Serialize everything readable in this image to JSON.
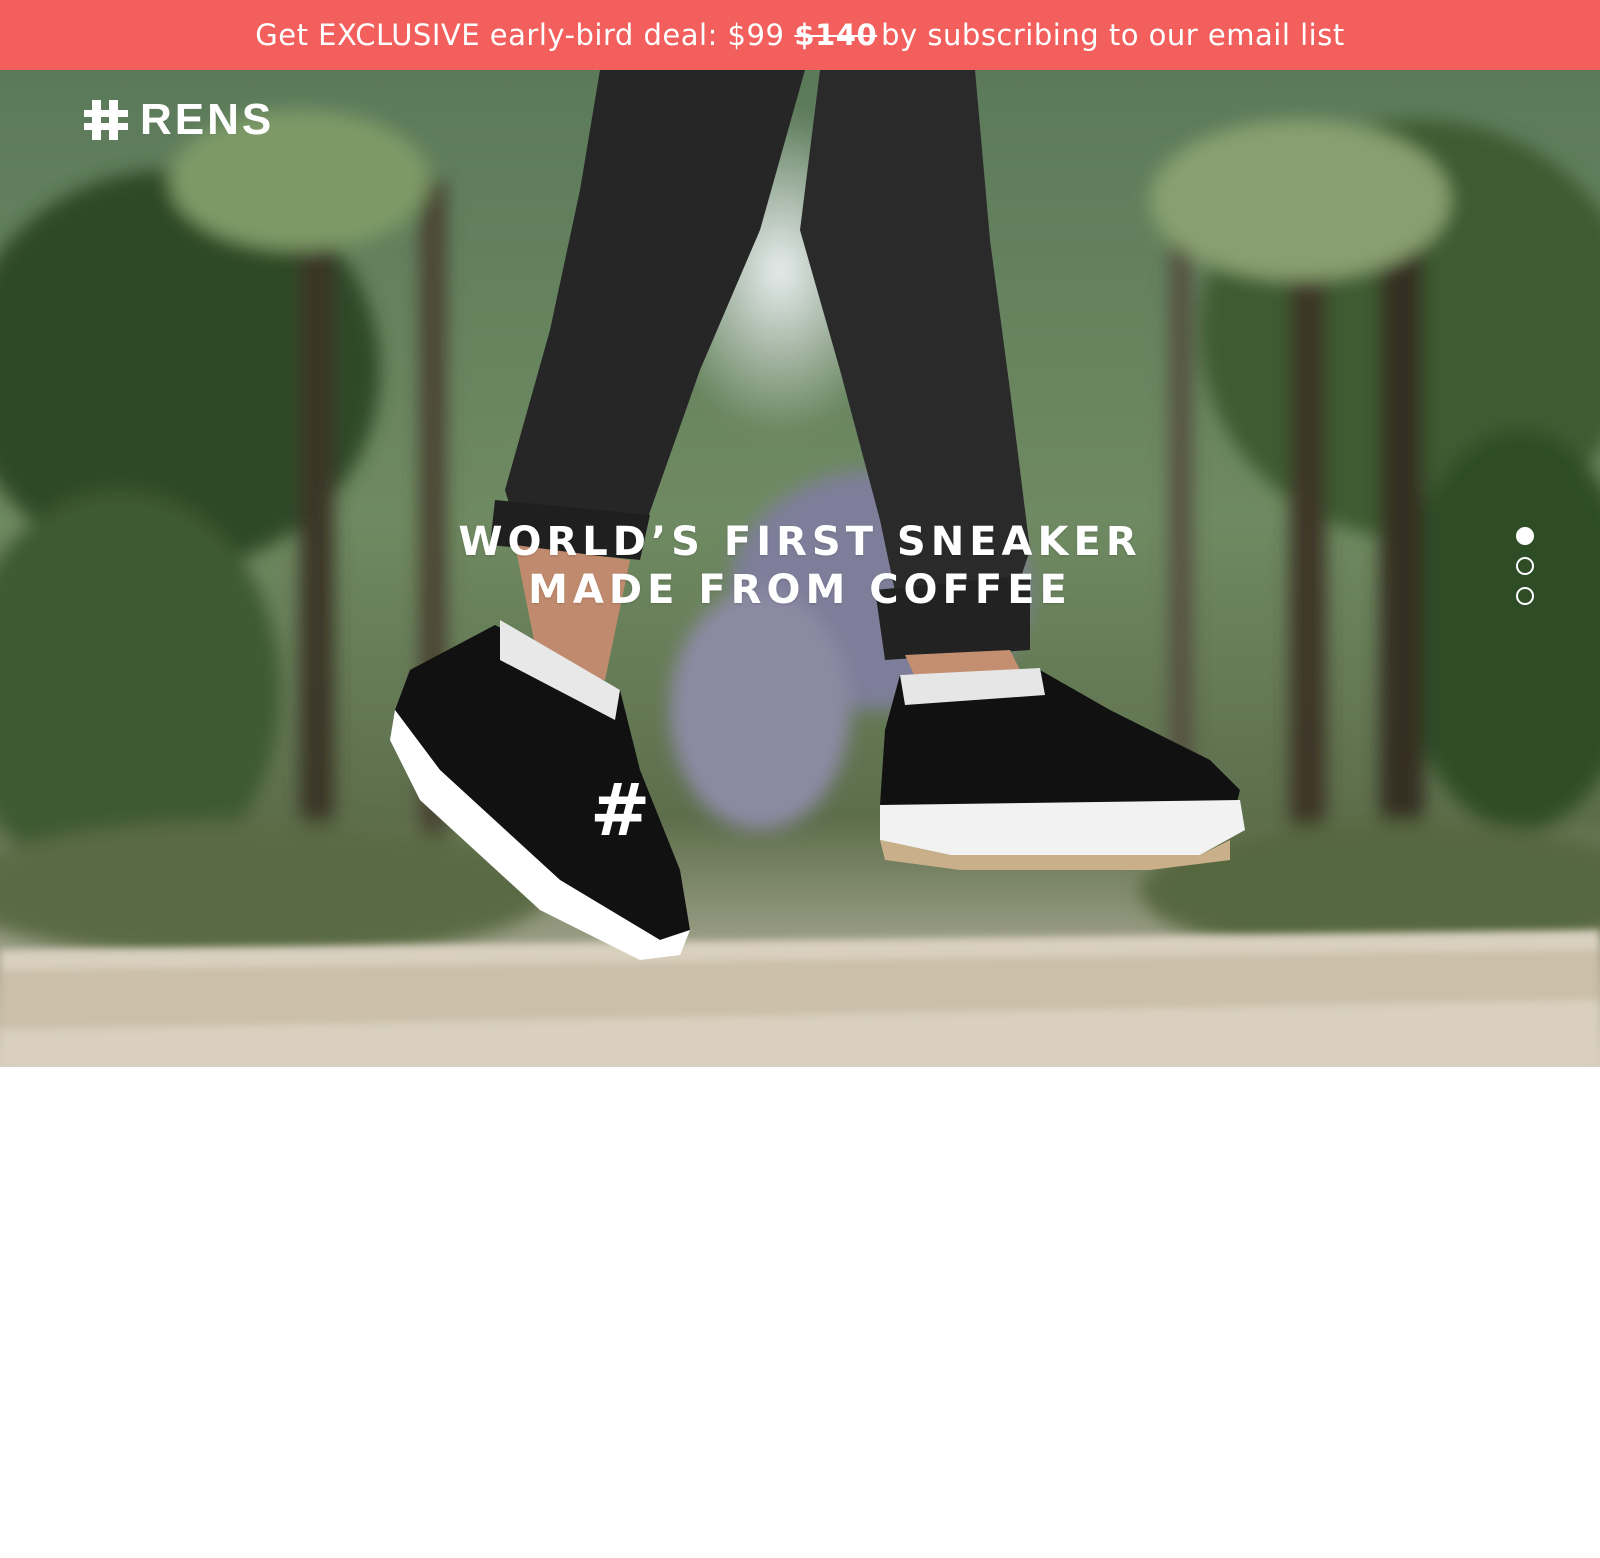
{
  "promo": {
    "prefix": "Get EXCLUSIVE early-bird deal: $99",
    "old_price": "$140",
    "suffix": "by subscribing to our email list",
    "background": "#f25f5c"
  },
  "header": {
    "logo_icon": "hash-icon",
    "logo_text": "RENS"
  },
  "hero": {
    "headline_line1": "WORLD’S FIRST SNEAKER",
    "headline_line2": "MADE FROM COFFEE",
    "image_subject": "jumping-person-wearing-black-sneakers",
    "slides": [
      {
        "active": true
      },
      {
        "active": false
      },
      {
        "active": false
      }
    ]
  }
}
